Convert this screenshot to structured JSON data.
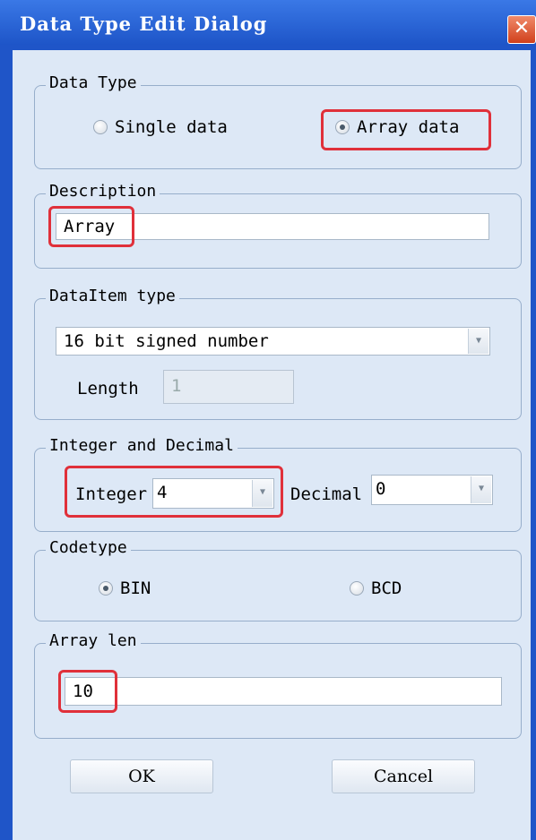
{
  "dialog": {
    "title": "Data Type Edit Dialog",
    "close_glyph": "✕"
  },
  "data_type": {
    "legend": "Data Type",
    "single_label": "Single data",
    "array_label": "Array data",
    "selected": "Array data"
  },
  "description": {
    "legend": "Description",
    "value": "Array"
  },
  "data_item": {
    "legend": "DataItem type",
    "selected": "16 bit signed number",
    "length_label": "Length",
    "length_value": "1"
  },
  "int_dec": {
    "legend": "Integer and Decimal",
    "integer_label": "Integer",
    "integer_value": "4",
    "decimal_label": "Decimal",
    "decimal_value": "0"
  },
  "codetype": {
    "legend": "Codetype",
    "bin_label": "BIN",
    "bcd_label": "BCD",
    "selected": "BIN"
  },
  "array_len": {
    "legend": "Array len",
    "value": "10"
  },
  "buttons": {
    "ok": "OK",
    "cancel": "Cancel"
  },
  "colors": {
    "titlebar": "#1f55c8",
    "client": "#dde8f6",
    "highlight": "#e0303a"
  },
  "icons": {
    "close": "close-icon",
    "dropdown": "chevron-down-icon"
  }
}
